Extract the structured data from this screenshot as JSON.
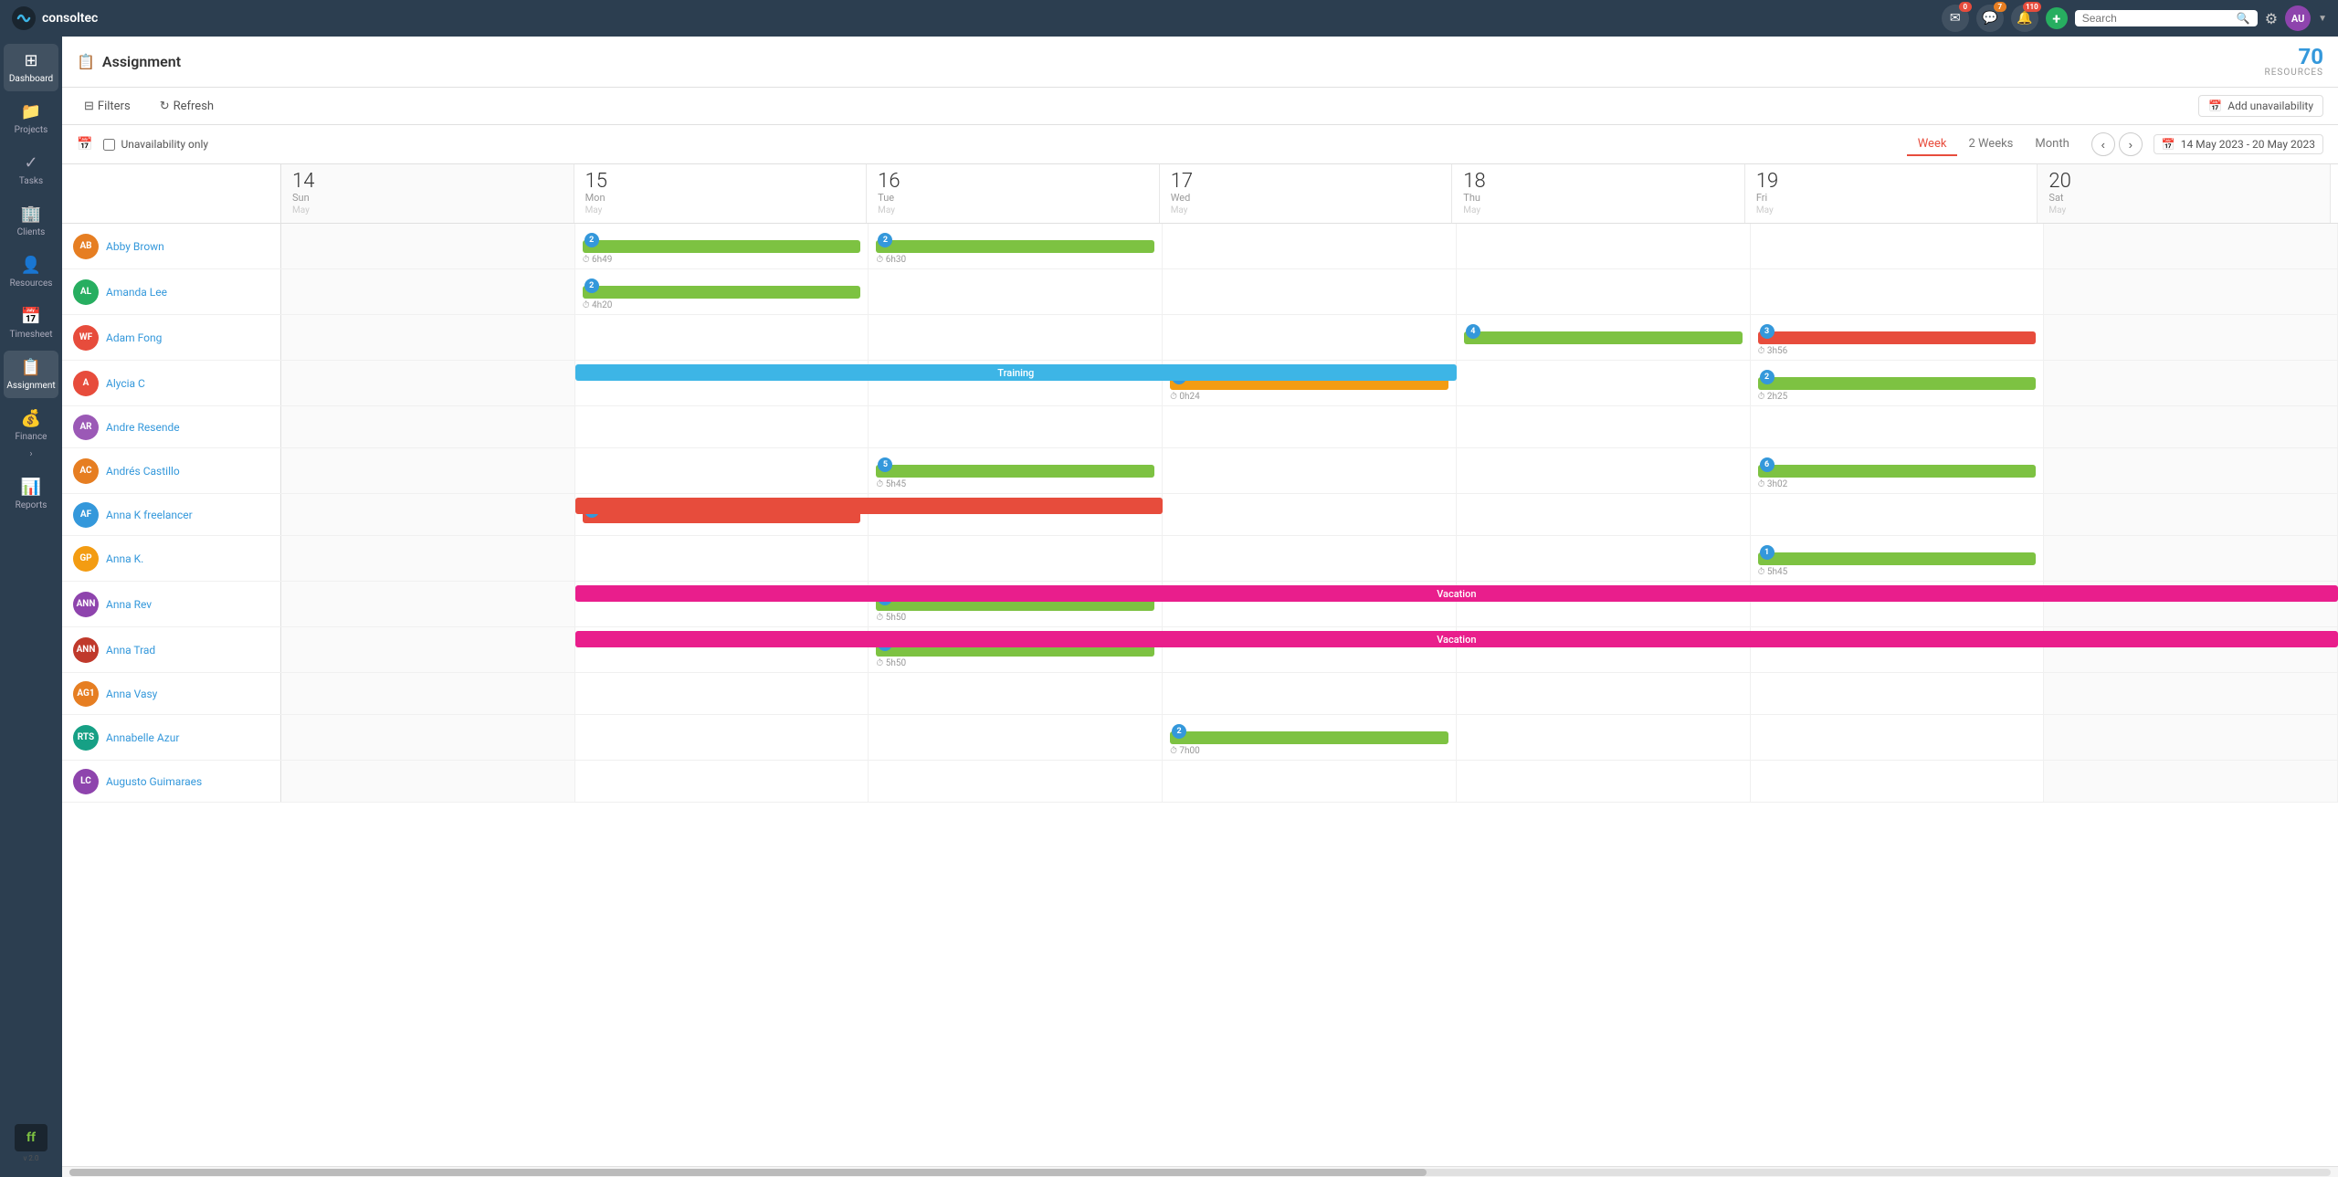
{
  "app": {
    "name": "consoltec",
    "logo_text": "ff",
    "version": "v 2.0"
  },
  "navbar": {
    "search_placeholder": "Search",
    "badge_email": "0",
    "badge_chat": "7",
    "badge_bell": "110",
    "settings_label": "Settings",
    "avatar_initials": "AU"
  },
  "sidebar": {
    "items": [
      {
        "label": "Dashboard",
        "icon": "⊞",
        "active": false
      },
      {
        "label": "Projects",
        "icon": "📁",
        "active": false
      },
      {
        "label": "Tasks",
        "icon": "✓",
        "active": false
      },
      {
        "label": "Clients",
        "icon": "🏢",
        "active": false
      },
      {
        "label": "Resources",
        "icon": "👤",
        "active": false
      },
      {
        "label": "Timesheet",
        "icon": "📅",
        "active": false
      },
      {
        "label": "Assignment",
        "icon": "📋",
        "active": true
      },
      {
        "label": "Finance",
        "icon": "💰",
        "active": false
      },
      {
        "label": "Reports",
        "icon": "📊",
        "active": false
      }
    ]
  },
  "page": {
    "title": "Assignment",
    "icon": "📋",
    "resources_count": "70",
    "resources_label": "RESOURCES"
  },
  "toolbar": {
    "filters_label": "Filters",
    "refresh_label": "Refresh",
    "add_unavailability_label": "Add unavailability"
  },
  "calendar": {
    "unavailability_only_label": "Unavailability only",
    "view_tabs": [
      "Week",
      "2 Weeks",
      "Month"
    ],
    "active_view": "Week",
    "date_range": "14 May 2023 - 20 May 2023",
    "days": [
      {
        "num": "14",
        "name": "Sun",
        "sub": "May",
        "weekend": true
      },
      {
        "num": "15",
        "name": "Mon",
        "sub": "May"
      },
      {
        "num": "16",
        "name": "Tue",
        "sub": "May"
      },
      {
        "num": "17",
        "name": "Wed",
        "sub": "May"
      },
      {
        "num": "18",
        "name": "Thu",
        "sub": "May"
      },
      {
        "num": "19",
        "name": "Fri",
        "sub": "May"
      },
      {
        "num": "20",
        "name": "Sat",
        "sub": "May",
        "weekend": true
      }
    ],
    "resources": [
      {
        "name": "Abby Brown",
        "initials": "AB",
        "color": "#e67e22",
        "events": [
          {
            "day": 1,
            "span": 1,
            "type": "green",
            "badge": 2,
            "time": "6h49"
          },
          {
            "day": 2,
            "span": 1,
            "type": "green",
            "badge": 2,
            "time": "6h30"
          }
        ]
      },
      {
        "name": "Amanda Lee",
        "initials": "AL",
        "color": "#27ae60",
        "events": [
          {
            "day": 1,
            "span": 1,
            "type": "green",
            "badge": 2,
            "time": "4h20"
          }
        ]
      },
      {
        "name": "Adam Fong",
        "initials": "WF",
        "color": "#e74c3c",
        "events": [
          {
            "day": 4,
            "span": 1,
            "type": "green",
            "badge": 4
          },
          {
            "day": 5,
            "span": 1,
            "type": "red",
            "time": "3h56",
            "badge": 3
          }
        ]
      },
      {
        "name": "Alycia C",
        "initials": "A",
        "color": "#e74c3c",
        "events": [
          {
            "day": 1,
            "span": 3,
            "type": "blue",
            "label": "Training"
          },
          {
            "day": 3,
            "span": 1,
            "type": "orange",
            "badge": 10,
            "time": "0h24"
          },
          {
            "day": 5,
            "span": 1,
            "type": "green",
            "badge": 2,
            "time": "2h25"
          }
        ]
      },
      {
        "name": "Andre Resende",
        "initials": "AR",
        "color": "#9b59b6",
        "events": []
      },
      {
        "name": "Andrés Castillo",
        "initials": "AC",
        "color": "#e67e22",
        "events": [
          {
            "day": 2,
            "span": 1,
            "type": "green",
            "badge": 5,
            "time": "5h45"
          },
          {
            "day": 5,
            "span": 1,
            "type": "green",
            "badge": 6,
            "time": "3h02"
          }
        ]
      },
      {
        "name": "Anna K freelancer",
        "initials": "AF",
        "color": "#3498db",
        "events": [
          {
            "day": 1,
            "span": 1,
            "type": "red",
            "badge": 1
          }
        ]
      },
      {
        "name": "Anna K.",
        "initials": "GP",
        "color": "#f39c12",
        "events": [
          {
            "day": 5,
            "span": 1,
            "type": "green",
            "badge": 1,
            "time": "5h45"
          }
        ]
      },
      {
        "name": "Anna Rev",
        "initials": "ANN",
        "color": "#8e44ad",
        "events": [
          {
            "day": 1,
            "span": 6,
            "type": "magenta",
            "label": "Vacation"
          },
          {
            "day": 2,
            "span": 1,
            "type": "green",
            "badge": 1,
            "time": "5h50"
          }
        ]
      },
      {
        "name": "Anna Trad",
        "initials": "ANN",
        "color": "#c0392b",
        "events": [
          {
            "day": 1,
            "span": 6,
            "type": "magenta",
            "label": "Vacation"
          },
          {
            "day": 2,
            "span": 1,
            "type": "green",
            "badge": 1,
            "time": "5h50"
          }
        ]
      },
      {
        "name": "Anna Vasy",
        "initials": "AG1",
        "color": "#e67e22",
        "events": []
      },
      {
        "name": "Annabelle Azur",
        "initials": "RTS",
        "color": "#16a085",
        "events": [
          {
            "day": 3,
            "span": 1,
            "type": "green",
            "badge": 2,
            "time": "7h00"
          }
        ]
      },
      {
        "name": "Augusto Guimaraes",
        "initials": "LC",
        "color": "#8e44ad",
        "events": []
      }
    ]
  },
  "colors": {
    "green_event": "#7dc242",
    "blue_event": "#3db5e6",
    "red_event": "#e74c3c",
    "orange_event": "#f39c12",
    "magenta_event": "#e91e8c",
    "accent_blue": "#3498db",
    "sidebar_bg": "#2c3e50",
    "active_tab": "#e74c3c"
  }
}
